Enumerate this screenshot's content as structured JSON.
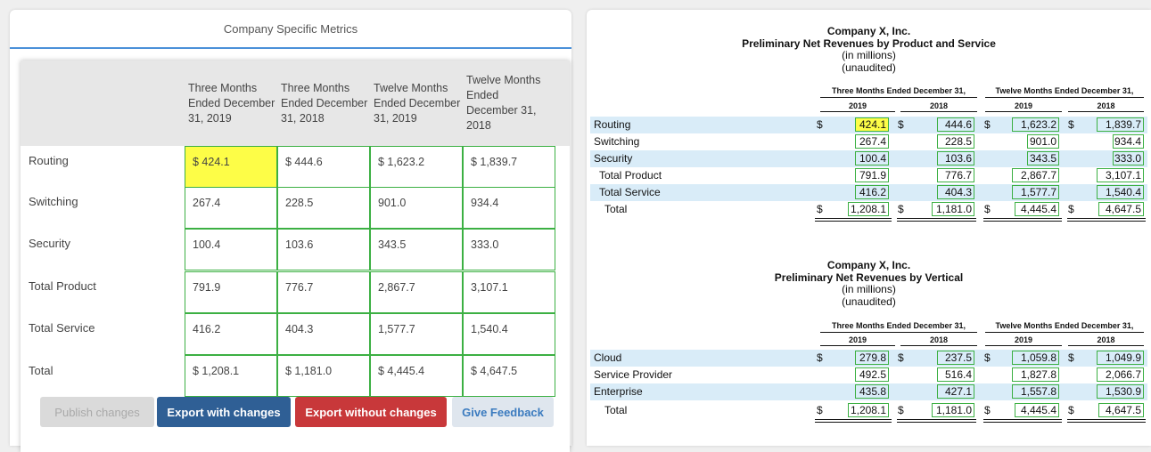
{
  "left_panel": {
    "title": "Company Specific Metrics",
    "columns": [
      "Three Months Ended December 31, 2019",
      "Three Months Ended December 31, 2018",
      "Twelve Months Ended December 31, 2019",
      "Twelve Months Ended December 31, 2018"
    ],
    "rows": [
      {
        "label": "Routing",
        "values": [
          "$ 424.1",
          "$ 444.6",
          "$ 1,623.2",
          "$ 1,839.7"
        ]
      },
      {
        "label": "Switching",
        "values": [
          "267.4",
          "228.5",
          "901.0",
          "934.4"
        ]
      },
      {
        "label": "Security",
        "values": [
          "100.4",
          "103.6",
          "343.5",
          "333.0"
        ]
      },
      {
        "label": "Total Product",
        "values": [
          "791.9",
          "776.7",
          "2,867.7",
          "3,107.1"
        ]
      },
      {
        "label": "Total Service",
        "values": [
          "416.2",
          "404.3",
          "1,577.7",
          "1,540.4"
        ]
      },
      {
        "label": "Total",
        "values": [
          "$ 1,208.1",
          "$ 1,181.0",
          "$ 4,445.4",
          "$ 4,647.5"
        ]
      }
    ],
    "highlight_color": "#fdfd47",
    "cell_border_color": "#3cb043",
    "buttons": {
      "publish": "Publish changes",
      "export_with": "Export with changes",
      "export_without": "Export without changes",
      "feedback": "Give Feedback"
    }
  },
  "right_panel": {
    "tables": [
      {
        "company": "Company X, Inc.",
        "title": "Preliminary Net Revenues by Product and Service",
        "units": "(in millions)",
        "audit": "(unaudited)",
        "group_headers": [
          "Three Months Ended December 31,",
          "Twelve Months Ended December 31,"
        ],
        "years": [
          "2019",
          "2018",
          "2019",
          "2018"
        ],
        "rows": [
          {
            "label": "Routing",
            "dollar": true,
            "values": [
              "424.1",
              "444.6",
              "1,623.2",
              "1,839.7"
            ]
          },
          {
            "label": "Switching",
            "dollar": false,
            "values": [
              "267.4",
              "228.5",
              "901.0",
              "934.4"
            ]
          },
          {
            "label": "Security",
            "dollar": false,
            "values": [
              "100.4",
              "103.6",
              "343.5",
              "333.0"
            ]
          },
          {
            "label": "Total Product",
            "dollar": false,
            "values": [
              "791.9",
              "776.7",
              "2,867.7",
              "3,107.1"
            ]
          },
          {
            "label": "Total Service",
            "dollar": false,
            "values": [
              "416.2",
              "404.3",
              "1,577.7",
              "1,540.4"
            ]
          },
          {
            "label": "Total",
            "dollar": true,
            "values": [
              "1,208.1",
              "1,181.0",
              "4,445.4",
              "4,647.5"
            ]
          }
        ]
      },
      {
        "company": "Company X, Inc.",
        "title": "Preliminary Net Revenues by Vertical",
        "units": "(in millions)",
        "audit": "(unaudited)",
        "group_headers": [
          "Three Months Ended December 31,",
          "Twelve Months Ended December 31,"
        ],
        "years": [
          "2019",
          "2018",
          "2019",
          "2018"
        ],
        "rows": [
          {
            "label": "Cloud",
            "dollar": true,
            "values": [
              "279.8",
              "237.5",
              "1,059.8",
              "1,049.9"
            ]
          },
          {
            "label": "Service Provider",
            "dollar": false,
            "values": [
              "492.5",
              "516.4",
              "1,827.8",
              "2,066.7"
            ]
          },
          {
            "label": "Enterprise",
            "dollar": false,
            "values": [
              "435.8",
              "427.1",
              "1,557.8",
              "1,530.9"
            ]
          },
          {
            "label": "Total",
            "dollar": true,
            "values": [
              "1,208.1",
              "1,181.0",
              "4,445.4",
              "4,647.5"
            ]
          }
        ]
      }
    ],
    "dollar_sign": "$",
    "row_band_color": "#d9ecf8"
  }
}
